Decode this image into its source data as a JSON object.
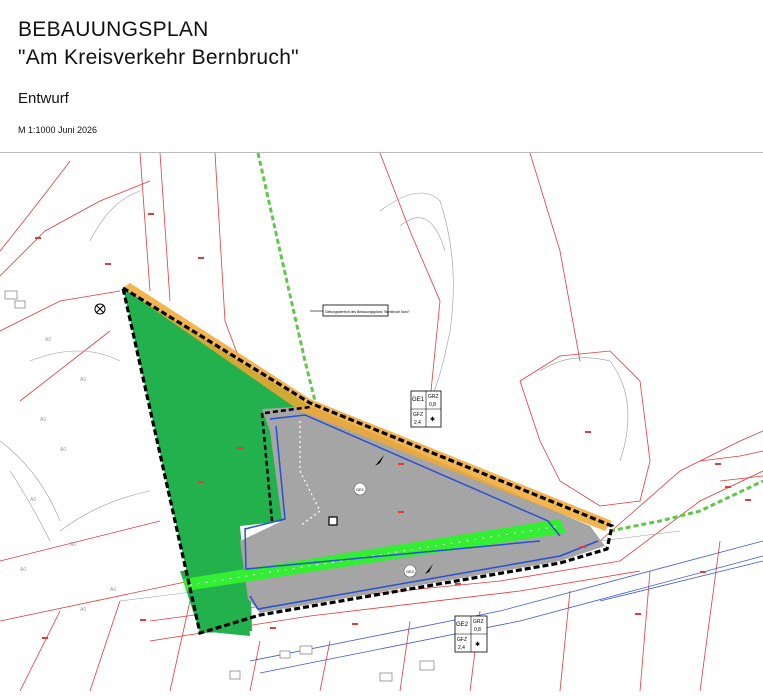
{
  "header": {
    "title_line1": "BEBAUUNGSPLAN",
    "title_line2": "\"Am Kreisverkehr Bernbruch\"",
    "status": "Entwurf",
    "scale_date": "M 1:1000  Juni 2026"
  },
  "colors": {
    "green_area": "#22b14c",
    "light_green_band": "#33ee33",
    "building_area": "#a6a6a6",
    "boundary": "#000000",
    "building_line": "#2a4fd0",
    "road_band": "#f0a830",
    "parcel_line": "#e23b3b",
    "path_dashed": "#5fc84a"
  },
  "map": {
    "callout_label": "Geltungsbereich des Bebauungsplans \"Bernbruch Nord\"",
    "zone_label_1": "GE1",
    "zone_label_2": "GE2",
    "keys": [
      {
        "zone": "GE1",
        "grz_label": "GRZ",
        "grz": "0,8",
        "gfz_label": "GFZ",
        "gfz": "2,4",
        "extra": "✱"
      },
      {
        "zone": "GE2",
        "grz_label": "GRZ",
        "grz": "0,8",
        "gfz_label": "GFZ",
        "gfz": "2,4",
        "extra": "✱"
      }
    ]
  }
}
